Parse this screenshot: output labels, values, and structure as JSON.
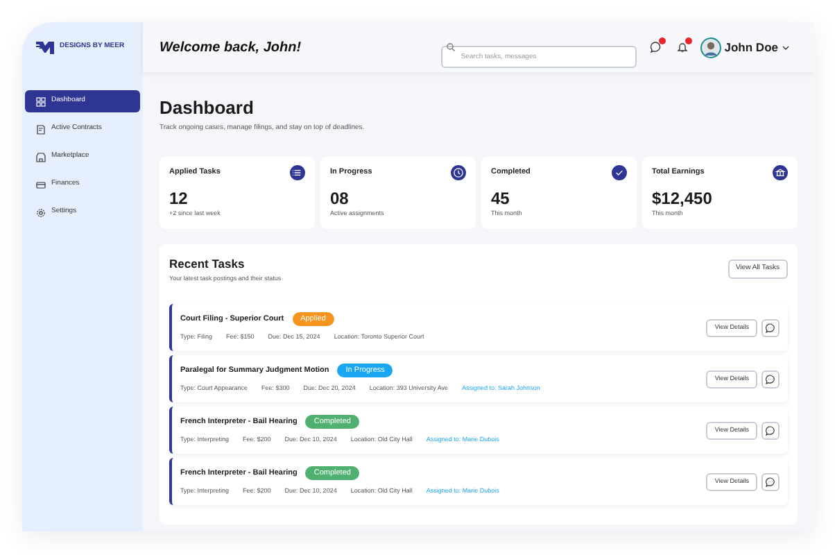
{
  "brand": {
    "name": "DESIGNS BY MEER"
  },
  "header": {
    "greeting": "Welcome back, John!",
    "search": {
      "placeholder": "Search tasks, messages"
    },
    "messages_unread": true,
    "notifications_unread": true,
    "user": {
      "name": "John Doe"
    }
  },
  "sidebar": {
    "items": [
      {
        "label": "Dashboard",
        "selected": true
      },
      {
        "label": "Active Contracts",
        "selected": false
      },
      {
        "label": "Marketplace",
        "selected": false
      },
      {
        "label": "Finances",
        "selected": false
      },
      {
        "label": "Settings",
        "selected": false
      }
    ]
  },
  "page": {
    "title": "Dashboard",
    "subtitle": "Track ongoing cases, manage filings, and stay on top of deadlines."
  },
  "stats": [
    {
      "label": "Applied Tasks",
      "value": "12",
      "note": "+2 since last week"
    },
    {
      "label": "In Progress",
      "value": "08",
      "note": "Active assignments"
    },
    {
      "label": "Completed",
      "value": "45",
      "note": "This month"
    },
    {
      "label": "Total Earnings",
      "value": "$12,450",
      "note": "This month"
    }
  ],
  "recent_tasks": {
    "title": "Recent Tasks",
    "subtitle": "Your latest task postings and their status",
    "view_all": "View All Tasks",
    "tasks": [
      {
        "title": "Court Filing - Superior Court",
        "status": "Applied",
        "color": "#f7941d",
        "details": [
          "Type: Filing",
          "Fee: $150",
          "Due: Dec 15, 2024",
          "Location: Toronto Superior Court"
        ],
        "action": "View Details"
      },
      {
        "title": "Paralegal for Summary Judgment Motion",
        "status": "In Progress",
        "color": "#1ba6f2",
        "details": [
          "Type: Court Appearance",
          "Fee: $300",
          "Due: Dec 20, 2024",
          "Location: 393 University Ave"
        ],
        "assigned": "Assigned to: Sarah Johnson",
        "action": "View Details"
      },
      {
        "title": "French Interpreter - Bail Hearing",
        "status": "Completed",
        "color": "#4fb06f",
        "details": [
          "Type: Interpreting",
          "Fee: $200",
          "Due: Dec 10, 2024",
          "Location: Old City Hall"
        ],
        "assigned": "Assigned to: Marie Dubois",
        "action": "View Details"
      },
      {
        "title": "French Interpreter - Bail Hearing",
        "status": "Completed",
        "color": "#4fb06f",
        "details": [
          "Type: Interpreting",
          "Fee: $200",
          "Due: Dec 10, 2024",
          "Location: Old City Hall"
        ],
        "assigned": "Assigned to: Marie Dubois",
        "action": "View Details"
      }
    ]
  }
}
